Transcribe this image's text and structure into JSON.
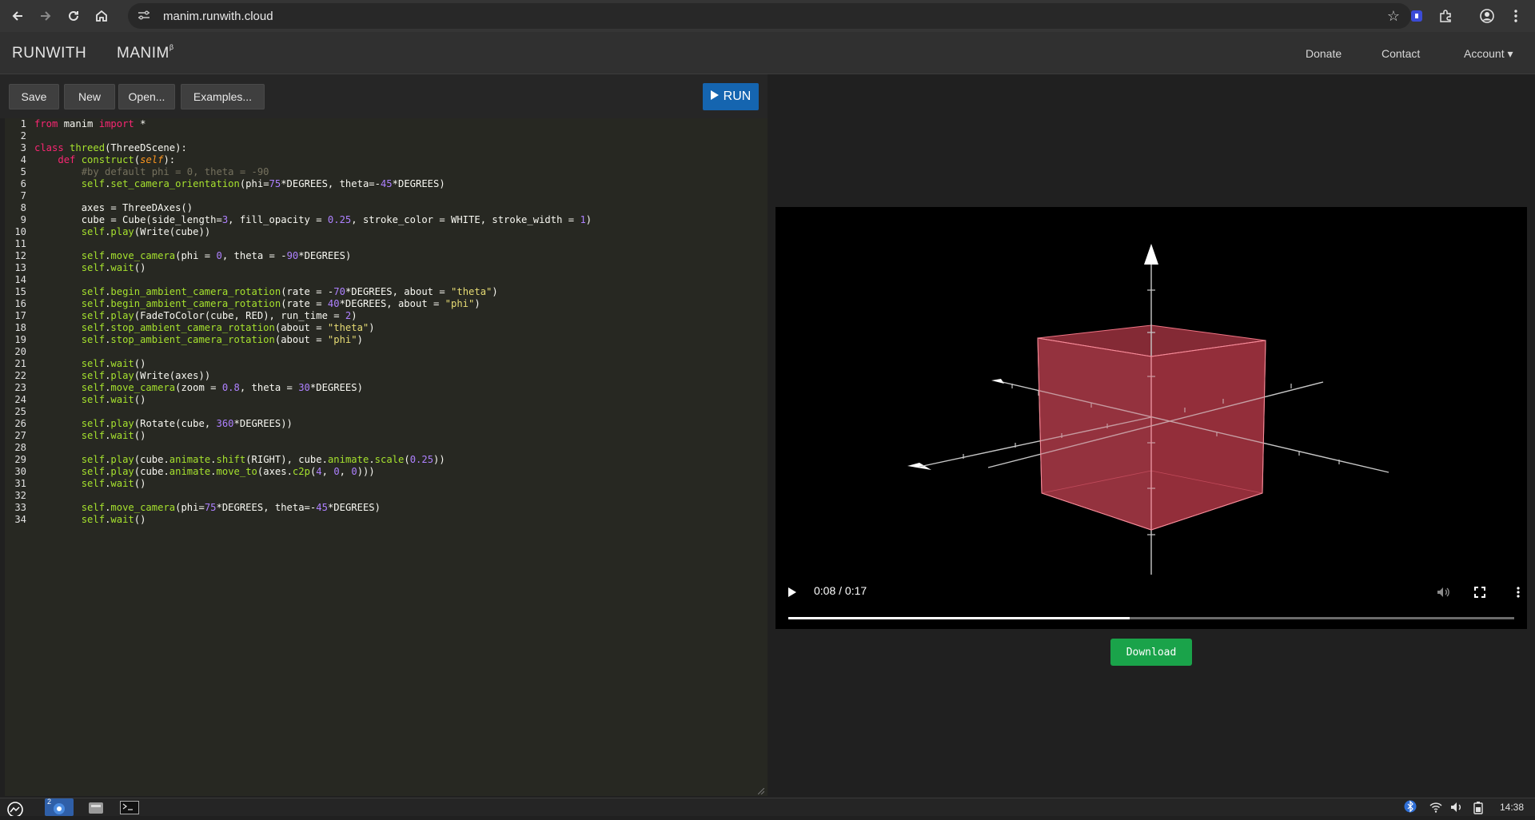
{
  "browser": {
    "url": "manim.runwith.cloud"
  },
  "header": {
    "brand_left": "RUNWITH",
    "brand_right": "MANIM",
    "brand_sup": "β",
    "nav": {
      "donate": "Donate",
      "contact": "Contact",
      "account": "Account ▾"
    }
  },
  "toolbar": {
    "save": "Save",
    "new": "New",
    "open": "Open...",
    "examples": "Examples...",
    "run": "RUN"
  },
  "editor": {
    "lines": [
      {
        "n": "1",
        "html": "<span class=\"tk-kw\">from</span> manim <span class=\"tk-kw\">import</span> *"
      },
      {
        "n": "2",
        "html": ""
      },
      {
        "n": "3",
        "html": "<span class=\"tk-kw\">class</span> <span class=\"tk-cls\">threed</span>(ThreeDScene):"
      },
      {
        "n": "4",
        "html": "    <span class=\"tk-kw\">def</span> <span class=\"tk-fn\">construct</span>(<span class=\"tk-self\">self</span>):"
      },
      {
        "n": "5",
        "html": "        <span class=\"tk-com\">#by default phi = 0, theta = -90</span>"
      },
      {
        "n": "6",
        "html": "        <span class=\"tk-slf\">self</span>.<span class=\"tk-fn\">set_camera_orientation</span>(phi=<span class=\"tk-num\">75</span>*DEGREES, theta=-<span class=\"tk-num\">45</span>*DEGREES)"
      },
      {
        "n": "7",
        "html": ""
      },
      {
        "n": "8",
        "html": "        axes = ThreeDAxes()"
      },
      {
        "n": "9",
        "html": "        cube = Cube(side_length=<span class=\"tk-num\">3</span>, fill_opacity = <span class=\"tk-num\">0.25</span>, stroke_color = WHITE, stroke_width = <span class=\"tk-num\">1</span>)"
      },
      {
        "n": "10",
        "html": "        <span class=\"tk-slf\">self</span>.<span class=\"tk-fn\">play</span>(Write(cube))"
      },
      {
        "n": "11",
        "html": ""
      },
      {
        "n": "12",
        "html": "        <span class=\"tk-slf\">self</span>.<span class=\"tk-fn\">move_camera</span>(phi = <span class=\"tk-num\">0</span>, theta = -<span class=\"tk-num\">90</span>*DEGREES)"
      },
      {
        "n": "13",
        "html": "        <span class=\"tk-slf\">self</span>.<span class=\"tk-fn\">wait</span>()"
      },
      {
        "n": "14",
        "html": ""
      },
      {
        "n": "15",
        "html": "        <span class=\"tk-slf\">self</span>.<span class=\"tk-fn\">begin_ambient_camera_rotation</span>(rate = -<span class=\"tk-num\">70</span>*DEGREES, about = <span class=\"tk-str\">\"theta\"</span>)"
      },
      {
        "n": "16",
        "html": "        <span class=\"tk-slf\">self</span>.<span class=\"tk-fn\">begin_ambient_camera_rotation</span>(rate = <span class=\"tk-num\">40</span>*DEGREES, about = <span class=\"tk-str\">\"phi\"</span>)"
      },
      {
        "n": "17",
        "html": "        <span class=\"tk-slf\">self</span>.<span class=\"tk-fn\">play</span>(FadeToColor(cube, RED), run_time = <span class=\"tk-num\">2</span>)"
      },
      {
        "n": "18",
        "html": "        <span class=\"tk-slf\">self</span>.<span class=\"tk-fn\">stop_ambient_camera_rotation</span>(about = <span class=\"tk-str\">\"theta\"</span>)"
      },
      {
        "n": "19",
        "html": "        <span class=\"tk-slf\">self</span>.<span class=\"tk-fn\">stop_ambient_camera_rotation</span>(about = <span class=\"tk-str\">\"phi\"</span>)"
      },
      {
        "n": "20",
        "html": ""
      },
      {
        "n": "21",
        "html": "        <span class=\"tk-slf\">self</span>.<span class=\"tk-fn\">wait</span>()"
      },
      {
        "n": "22",
        "html": "        <span class=\"tk-slf\">self</span>.<span class=\"tk-fn\">play</span>(Write(axes))"
      },
      {
        "n": "23",
        "html": "        <span class=\"tk-slf\">self</span>.<span class=\"tk-fn\">move_camera</span>(zoom = <span class=\"tk-num\">0.8</span>, theta = <span class=\"tk-num\">30</span>*DEGREES)"
      },
      {
        "n": "24",
        "html": "        <span class=\"tk-slf\">self</span>.<span class=\"tk-fn\">wait</span>()"
      },
      {
        "n": "25",
        "html": ""
      },
      {
        "n": "26",
        "html": "        <span class=\"tk-slf\">self</span>.<span class=\"tk-fn\">play</span>(Rotate(cube, <span class=\"tk-num\">360</span>*DEGREES))"
      },
      {
        "n": "27",
        "html": "        <span class=\"tk-slf\">self</span>.<span class=\"tk-fn\">wait</span>()"
      },
      {
        "n": "28",
        "html": ""
      },
      {
        "n": "29",
        "html": "        <span class=\"tk-slf\">self</span>.<span class=\"tk-fn\">play</span>(cube.<span class=\"tk-fn\">animate</span>.<span class=\"tk-fn\">shift</span>(RIGHT), cube.<span class=\"tk-fn\">animate</span>.<span class=\"tk-fn\">scale</span>(<span class=\"tk-num\">0.25</span>))"
      },
      {
        "n": "30",
        "html": "        <span class=\"tk-slf\">self</span>.<span class=\"tk-fn\">play</span>(cube.<span class=\"tk-fn\">animate</span>.<span class=\"tk-fn\">move_to</span>(axes.<span class=\"tk-fn\">c2p</span>(<span class=\"tk-num\">4</span>, <span class=\"tk-num\">0</span>, <span class=\"tk-num\">0</span>)))"
      },
      {
        "n": "31",
        "html": "        <span class=\"tk-slf\">self</span>.<span class=\"tk-fn\">wait</span>()"
      },
      {
        "n": "32",
        "html": ""
      },
      {
        "n": "33",
        "html": "        <span class=\"tk-slf\">self</span>.<span class=\"tk-fn\">move_camera</span>(phi=<span class=\"tk-num\">75</span>*DEGREES, theta=-<span class=\"tk-num\">45</span>*DEGREES)"
      },
      {
        "n": "34",
        "html": "        <span class=\"tk-slf\">self</span>.<span class=\"tk-fn\">wait</span>()"
      }
    ]
  },
  "video": {
    "time": "0:08 / 0:17",
    "progress": 0.47,
    "icons": [
      "play-icon",
      "volume-icon",
      "fullscreen-icon",
      "more-icon"
    ]
  },
  "download": {
    "label": "Download"
  },
  "taskbar": {
    "badge": "2",
    "clock": "14:38"
  },
  "colors": {
    "run": "#1565b0",
    "download": "#1aa34a",
    "cube": "#d84b5a"
  }
}
